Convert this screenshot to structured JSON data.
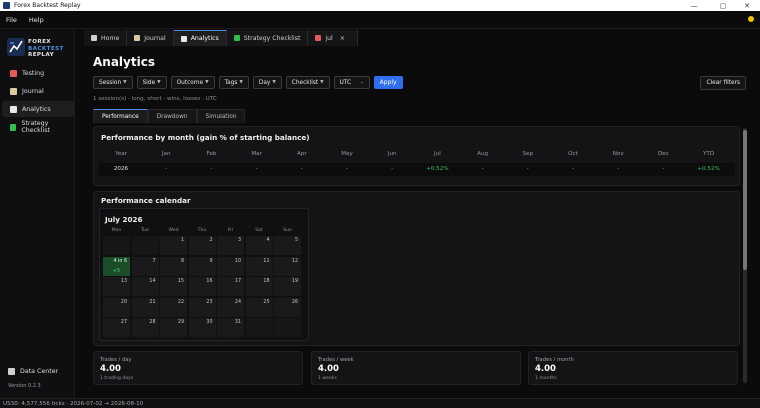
{
  "window": {
    "title": "Forex Backtest Replay",
    "minimize": "—",
    "maximize": "▢",
    "close": "✕"
  },
  "menu": [
    "File",
    "Help"
  ],
  "logo": {
    "line1": "FOREX",
    "line2": "BACKTEST",
    "line3": "REPLAY"
  },
  "sidebar": {
    "items": [
      {
        "label": "Testing",
        "icon": "chart-icon",
        "color": "#e35b5b",
        "active": false
      },
      {
        "label": "Journal",
        "icon": "notebook-icon",
        "color": "#d8c9a3",
        "active": false
      },
      {
        "label": "Analytics",
        "icon": "analytics-icon",
        "color": "#e8e8e8",
        "active": true
      },
      {
        "label": "Strategy  Checklist",
        "icon": "checkbox-icon",
        "color": "#2fbf4f",
        "active": false
      }
    ],
    "data_center": "Data Center",
    "version": "Version 0.2.3"
  },
  "tabs": [
    {
      "label": "Home",
      "icon": "home-icon",
      "active": false
    },
    {
      "label": "Journal",
      "icon": "notebook-icon",
      "active": false
    },
    {
      "label": "Analytics",
      "icon": "analytics-icon",
      "active": true
    },
    {
      "label": "Strategy  Checklist",
      "icon": "checkbox-icon",
      "active": false
    },
    {
      "label": "jul",
      "icon": "chart-icon",
      "active": false
    }
  ],
  "tab_close": "×",
  "page": {
    "title": "Analytics",
    "filters": [
      "Session",
      "Side",
      "Outcome",
      "Tags",
      "Day",
      "Checklist"
    ],
    "timezone": "UTC",
    "apply": "Apply",
    "clear": "Clear filters",
    "summary": "1 session(s)  ·  long, short  ·  wins, losses  ·  UTC",
    "subtabs": [
      "Performance",
      "Drawdown",
      "Simulation"
    ]
  },
  "perf_by_month": {
    "title": "Performance by month  (gain % of starting balance)",
    "headers": [
      "Year",
      "Jan",
      "Feb",
      "Mar",
      "Apr",
      "May",
      "Jun",
      "Jul",
      "Aug",
      "Sep",
      "Oct",
      "Nov",
      "Dec",
      "YTD"
    ],
    "row": [
      "2026",
      "-",
      "-",
      "-",
      "-",
      "-",
      "-",
      "+0.52%",
      "-",
      "-",
      "-",
      "-",
      "-",
      "+0.52%"
    ]
  },
  "calendar": {
    "title": "Performance calendar",
    "month": "July 2026",
    "dow": [
      "Mon",
      "Tue",
      "Wed",
      "Thu",
      "Fri",
      "Sat",
      "Sun"
    ],
    "days": [
      "1",
      "2",
      "3",
      "4",
      "5",
      "6",
      "7",
      "8",
      "9",
      "10",
      "11",
      "12",
      "13",
      "14",
      "15",
      "16",
      "17",
      "18",
      "19",
      "20",
      "21",
      "22",
      "23",
      "24",
      "25",
      "26",
      "27",
      "28",
      "29",
      "30",
      "31"
    ],
    "win_day_label": "4 in 6",
    "win_day_pnl": "+5"
  },
  "stats": [
    {
      "label": "Trades / day",
      "value": "4.00",
      "sub": "1 trading days"
    },
    {
      "label": "Trades / week",
      "value": "4.00",
      "sub": "1 weeks"
    },
    {
      "label": "Trades / month",
      "value": "4.00",
      "sub": "1 months"
    }
  ],
  "status_bar": "US30: 4,577,556 ticks · 2026-07-02 → 2026-08-10"
}
